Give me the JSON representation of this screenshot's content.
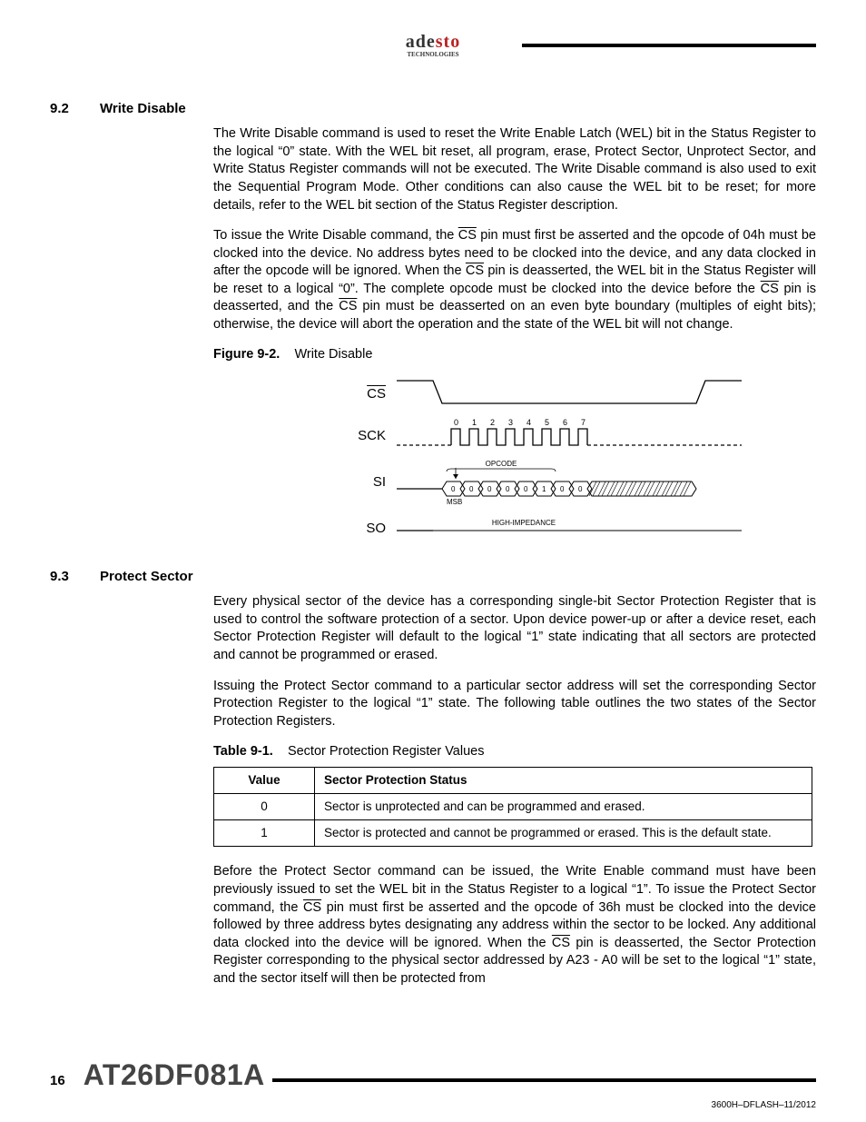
{
  "logo": {
    "part1": "ade",
    "part2": "sto",
    "sub": "TECHNOLOGIES"
  },
  "s92": {
    "num": "9.2",
    "title": "Write Disable",
    "p1": "The Write Disable command is used to reset the Write Enable Latch (WEL) bit in the Status Register to the logical “0” state. With the WEL bit reset, all program, erase, Protect Sector, Unprotect Sector, and Write Status Register commands will not be executed. The Write Disable command is also used to exit the Sequential Program Mode. Other conditions can also cause the WEL bit to be reset; for more details, refer to the WEL bit section of the Status Register description.",
    "p2a": "To issue the Write Disable command, the ",
    "p2b": " pin must first be asserted and the opcode of 04h must be clocked into the device. No address bytes need to be clocked into the device, and any data clocked in after the opcode will be ignored. When the ",
    "p2c": " pin is deasserted, the WEL bit in the Status Register will be reset to a logical “0”. The complete opcode must be clocked into the device before the ",
    "p2d": " pin is deasserted, and the ",
    "p2e": " pin must be deasserted on an even byte boundary (multiples of eight bits); otherwise, the device will abort the operation and the state of the WEL bit will not change."
  },
  "fig92": {
    "label": "Figure 9-2.",
    "title": "Write Disable",
    "signals": {
      "cs": "CS",
      "sck": "SCK",
      "si": "SI",
      "so": "SO"
    },
    "ticks": [
      "0",
      "1",
      "2",
      "3",
      "4",
      "5",
      "6",
      "7"
    ],
    "opcode_label": "OPCODE",
    "opcode_bits": [
      "0",
      "0",
      "0",
      "0",
      "0",
      "1",
      "0",
      "0"
    ],
    "msb": "MSB",
    "hiz": "HIGH-IMPEDANCE"
  },
  "s93": {
    "num": "9.3",
    "title": "Protect Sector",
    "p1": "Every physical sector of the device has a corresponding single-bit Sector Protection Register that is used to control the software protection of a sector. Upon device power-up or after a device reset, each Sector Protection Register will default to the logical “1” state indicating that all sectors are protected and cannot be programmed or erased.",
    "p2": "Issuing the Protect Sector command to a particular sector address will set the corresponding Sector Protection Register to the logical “1” state. The following table outlines the two states of the Sector Protection Registers.",
    "p3a": "Before the Protect Sector command can be issued, the Write Enable command must have been previously issued to set the WEL bit in the Status Register to a logical “1”. To issue the Protect Sector command, the ",
    "p3b": " pin must first be asserted and the opcode of 36h must be clocked into the device followed by three address bytes designating any address within the sector to be locked. Any additional data clocked into the device will be ignored. When the ",
    "p3c": " pin is deasserted, the Sector Protection Register corresponding to the physical sector addressed by A23 - A0 will be set to the logical “1” state, and the sector itself will then be protected from"
  },
  "tbl91": {
    "label": "Table 9-1.",
    "title": "Sector Protection Register Values",
    "head": {
      "c1": "Value",
      "c2": "Sector Protection Status"
    },
    "rows": [
      {
        "v": "0",
        "s": "Sector is unprotected and can be programmed and erased."
      },
      {
        "v": "1",
        "s": "Sector is protected and cannot be programmed or erased. This is the default state."
      }
    ]
  },
  "cs": "CS",
  "footer": {
    "page": "16",
    "part": "AT26DF081A",
    "docid": "3600H–DFLASH–11/2012"
  }
}
